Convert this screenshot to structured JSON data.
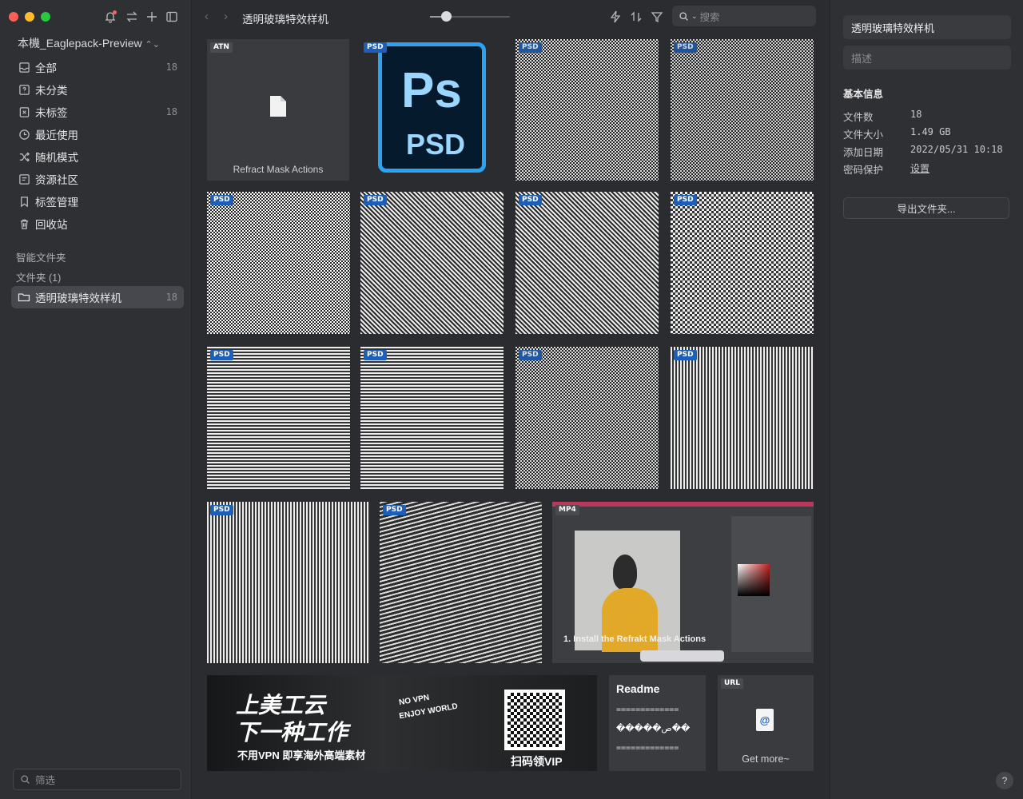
{
  "sidebar": {
    "library_name": "本機_Eaglepack-Preview",
    "library_chevron": "⌃",
    "nav": [
      {
        "label": "全部",
        "count": "18",
        "icon": "inbox-icon"
      },
      {
        "label": "未分类",
        "count": "",
        "icon": "question-icon"
      },
      {
        "label": "未标签",
        "count": "18",
        "icon": "untagged-icon"
      },
      {
        "label": "最近使用",
        "count": "",
        "icon": "clock-icon"
      },
      {
        "label": "随机模式",
        "count": "",
        "icon": "shuffle-icon"
      },
      {
        "label": "资源社区",
        "count": "",
        "icon": "community-icon"
      },
      {
        "label": "标签管理",
        "count": "",
        "icon": "bookmark-icon"
      },
      {
        "label": "回收站",
        "count": "",
        "icon": "trash-icon"
      }
    ],
    "smart_folders": "智能文件夹",
    "folders": "文件夹 (1)",
    "folder_item": {
      "label": "透明玻璃特效样机",
      "count": "18"
    },
    "filter_placeholder": "筛选"
  },
  "toolbar": {
    "breadcrumb": "透明玻璃特效样机",
    "zoom_level": 0.2,
    "search_placeholder": "搜索"
  },
  "grid": {
    "atn_badge": "ATN",
    "atn_caption": "Refract Mask Actions",
    "psd_badge": "PSD",
    "ps_icon_top": "Ps",
    "ps_icon_bottom": "PSD",
    "mp4_badge": "MP4",
    "mp4_caption": "1. Install the Refrakt Mask Actions",
    "banner": {
      "line1": "上美工云",
      "line2": "下一种工作",
      "line3": "不用VPN 即享海外高端素材",
      "no_vpn": "NO VPN",
      "enjoy": "ENJOY WORLD",
      "qr_caption": "扫码领VIP"
    },
    "readme_title": "Readme",
    "readme_line1": "=============",
    "readme_line2": "�����ص��",
    "readme_line3": "=============",
    "url_badge": "URL",
    "url_caption": "Get more~"
  },
  "panel": {
    "title": "透明玻璃特效样机",
    "desc_placeholder": "描述",
    "section": "基本信息",
    "rows": [
      {
        "label": "文件数",
        "value": "18"
      },
      {
        "label": "文件大小",
        "value": "1.49 GB"
      },
      {
        "label": "添加日期",
        "value": "2022/05/31 10:18"
      },
      {
        "label": "密码保护",
        "value": "设置"
      }
    ],
    "export_label": "导出文件夹...",
    "help": "?"
  },
  "colors": {
    "accent_badge": "#1d5fb8",
    "bg": "#2b2c2f",
    "sidebar": "#2f3033"
  }
}
